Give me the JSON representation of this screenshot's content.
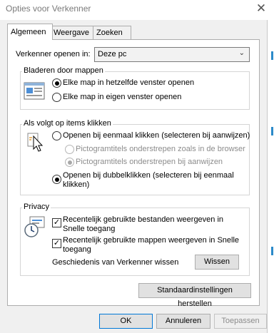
{
  "window": {
    "title": "Opties voor Verkenner"
  },
  "tabs": [
    {
      "label": "Algemeen",
      "active": true
    },
    {
      "label": "Weergave",
      "active": false
    },
    {
      "label": "Zoeken",
      "active": false
    }
  ],
  "open_in": {
    "label": "Verkenner openen in:",
    "value": "Deze pc"
  },
  "browse": {
    "title": "Bladeren door mappen",
    "options": [
      {
        "label": "Elke map in hetzelfde venster openen",
        "selected": true
      },
      {
        "label": "Elke map in eigen venster openen",
        "selected": false
      }
    ]
  },
  "click": {
    "title": "Als volgt op items klikken",
    "single": {
      "label": "Openen bij eenmaal klikken (selecteren bij aanwijzen)",
      "selected": false
    },
    "underline_browser": {
      "label": "Pictogramtitels onderstrepen zoals in de browser",
      "selected": false,
      "disabled": true
    },
    "underline_hover": {
      "label": "Pictogramtitels onderstrepen bij aanwijzen",
      "selected": true,
      "disabled": true
    },
    "double": {
      "line1": "Openen bij dubbelklikken (selecteren bij eenmaal",
      "line2": "klikken)",
      "selected": true
    }
  },
  "privacy": {
    "title": "Privacy",
    "recent_files": {
      "line1": "Recentelijk gebruikte bestanden weergeven in",
      "line2": "Snelle toegang",
      "checked": true
    },
    "recent_folders": {
      "line1": "Recentelijk gebruikte mappen weergeven in Snelle",
      "line2": "toegang",
      "checked": true
    },
    "clear_label": "Geschiedenis van Verkenner wissen",
    "clear_button": "Wissen"
  },
  "restore_button": "Standaardinstellingen herstellen",
  "footer": {
    "ok": "OK",
    "cancel": "Annuleren",
    "apply": "Toepassen"
  },
  "colors": {
    "accent": "#0078d7",
    "dialog_bg": "#f0f0f0"
  }
}
